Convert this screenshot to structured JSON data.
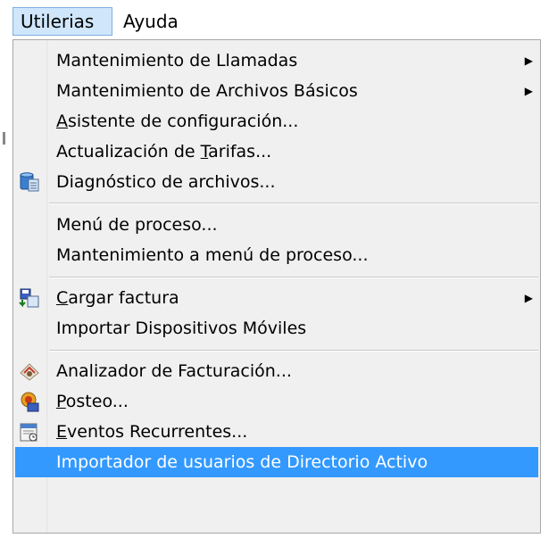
{
  "menubar": {
    "items": [
      {
        "label": "Utilerias",
        "active": true
      },
      {
        "label": "Ayuda",
        "active": false
      }
    ]
  },
  "menu": {
    "groups": [
      [
        {
          "label": "Mantenimiento de Llamadas",
          "submenu": true
        },
        {
          "label": "Mantenimiento de Archivos Básicos",
          "submenu": true
        },
        {
          "label": "Asistente de configuración...",
          "underline": "A"
        },
        {
          "label": "Actualización de Tarifas...",
          "underline": "T"
        },
        {
          "label": "Diagnóstico de archivos...",
          "icon": "database-diagnostic-icon"
        }
      ],
      [
        {
          "label": "Menú de proceso..."
        },
        {
          "label": "Mantenimiento a menú de proceso..."
        }
      ],
      [
        {
          "label": "Cargar factura",
          "submenu": true,
          "icon": "load-invoice-icon",
          "underline": "C"
        },
        {
          "label": "Importar Dispositivos Móviles"
        }
      ],
      [
        {
          "label": "Analizador de Facturación...",
          "icon": "analyzer-icon"
        },
        {
          "label": "Posteo...",
          "icon": "posting-icon",
          "underline": "P"
        },
        {
          "label": "Eventos Recurrentes...",
          "icon": "calendar-icon",
          "underline": "E"
        },
        {
          "label": "Importador de usuarios de Directorio Activo",
          "highlighted": true
        }
      ]
    ]
  },
  "colors": {
    "highlight": "#3399ff",
    "menu_bg": "#f0f0f0",
    "active_menubar": "#cfe6fb"
  }
}
